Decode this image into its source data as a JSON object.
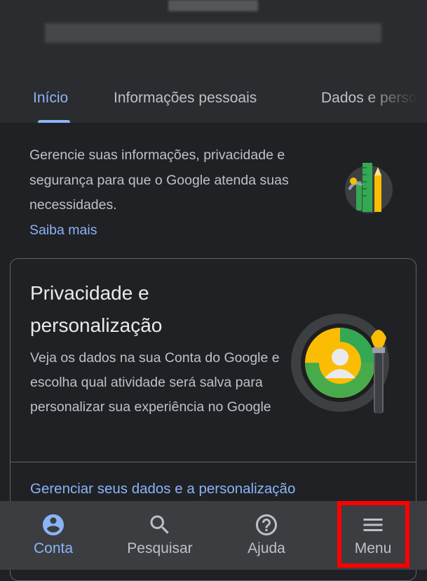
{
  "tabs": [
    {
      "label": "Início"
    },
    {
      "label": "Informações pessoais"
    },
    {
      "label": "Dados e personalização"
    }
  ],
  "intro": {
    "text": "Gerencie suas informações, privacidade e segurança para que o Google atenda suas necessidades.",
    "link": "Saiba mais"
  },
  "card": {
    "title": "Privacidade e personalização",
    "description": "Veja os dados na sua Conta do Google e escolha qual atividade será salva para personalizar sua experiência no Google",
    "link": "Gerenciar seus dados e a personalização"
  },
  "bottom_nav": [
    {
      "label": "Conta",
      "icon": "account-circle-icon"
    },
    {
      "label": "Pesquisar",
      "icon": "search-icon"
    },
    {
      "label": "Ajuda",
      "icon": "help-icon"
    },
    {
      "label": "Menu",
      "icon": "menu-icon"
    }
  ],
  "colors": {
    "accent": "#8ab4f8",
    "background": "#202124",
    "highlight": "#ff0000"
  }
}
